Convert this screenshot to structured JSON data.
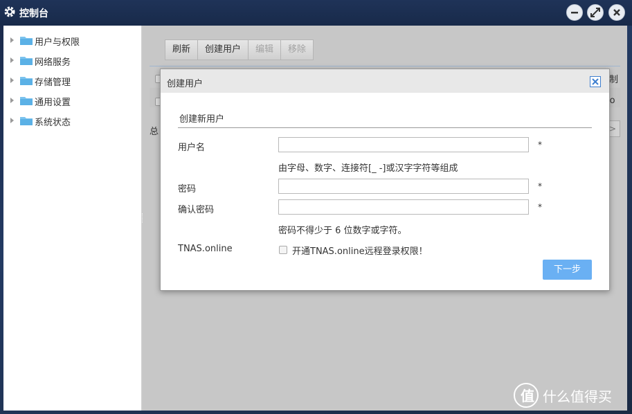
{
  "window": {
    "title": "控制台"
  },
  "sidebar": {
    "items": [
      {
        "label": "用户与权限"
      },
      {
        "label": "网络服务"
      },
      {
        "label": "存储管理"
      },
      {
        "label": "通用设置"
      },
      {
        "label": "系统状态"
      }
    ]
  },
  "toolbar": {
    "refresh_label": "刷新",
    "create_label": "创建用户",
    "edit_label": "编辑",
    "remove_label": "移除"
  },
  "background_list": {
    "header_fragment": "制",
    "row_fragment": "lo",
    "total_fragment": "总",
    "next_page": ">"
  },
  "dialog": {
    "title": "创建用户",
    "section_title": "创建新用户",
    "username_label": "用户名",
    "username_value": "",
    "username_hint": "由字母、数字、连接符[_ -]或汉字字符等组成",
    "password_label": "密码",
    "password_value": "",
    "confirm_label": "确认密码",
    "confirm_value": "",
    "password_hint": "密码不得少于 6 位数字或字符。",
    "required_mark": "*",
    "tnas_label": "TNAS.online",
    "tnas_checkbox_label": "开通TNAS.online远程登录权限！",
    "tnas_checked": false,
    "next_label": "下一步"
  },
  "watermark": {
    "glyph": "值",
    "text": "什么值得买"
  },
  "colors": {
    "titlebar": "#1f3358",
    "primary_button": "#6ab0f3",
    "close_border": "#3f7fcf"
  }
}
